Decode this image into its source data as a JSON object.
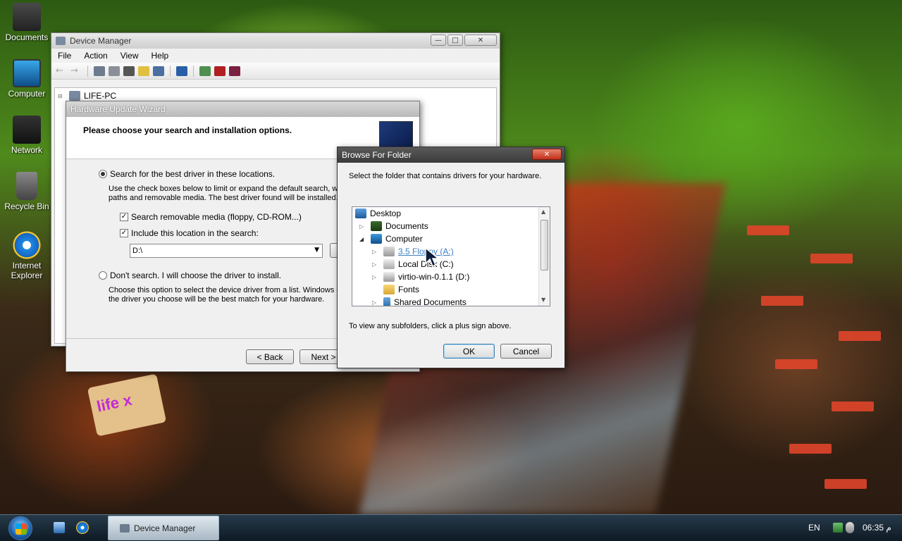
{
  "desktop": {
    "icons": [
      {
        "label": "Documents"
      },
      {
        "label": "Computer"
      },
      {
        "label": "Network"
      },
      {
        "label": "Recycle Bin"
      },
      {
        "label": "Internet\nExplorer"
      }
    ],
    "wallpaper_logo": "life x"
  },
  "device_manager": {
    "title": "Device Manager",
    "menu": [
      "File",
      "Action",
      "View",
      "Help"
    ],
    "tree_root": "LIFE-PC"
  },
  "wizard": {
    "title": "Hardware Update Wizard",
    "heading": "Please choose your search and installation options.",
    "option_search": "Search for the best driver in these locations.",
    "search_desc_1": "Use the check boxes below to limit or expand the default search, wh",
    "search_desc_2": "paths and removable media. The best driver found will be installed.",
    "check_removable": "Search removable media (floppy, CD-ROM...)",
    "check_include": "Include this location in the search:",
    "location_value": "D:\\",
    "option_dont": "Don't search. I will choose the driver to install.",
    "dont_desc_1": "Choose this option to select the device driver from a list.  Windows d",
    "dont_desc_2": "the driver you choose will be the best match for your hardware.",
    "back_label": "< Back",
    "next_label": "Next >"
  },
  "browse": {
    "title": "Browse For Folder",
    "instruction": "Select the folder that contains drivers for your hardware.",
    "tree": [
      {
        "label": "Desktop"
      },
      {
        "label": "Documents"
      },
      {
        "label": "Computer"
      },
      {
        "label": "3.5 Floppy (A:)"
      },
      {
        "label": "Local Disk (C:)"
      },
      {
        "label": "virtio-win-0.1.1 (D:)"
      },
      {
        "label": "Fonts"
      },
      {
        "label": "Shared Documents"
      }
    ],
    "hint": "To view any subfolders, click a plus sign above.",
    "ok_label": "OK",
    "cancel_label": "Cancel"
  },
  "taskbar": {
    "task_label": "Device Manager",
    "language": "EN",
    "clock": "06:35 م"
  }
}
